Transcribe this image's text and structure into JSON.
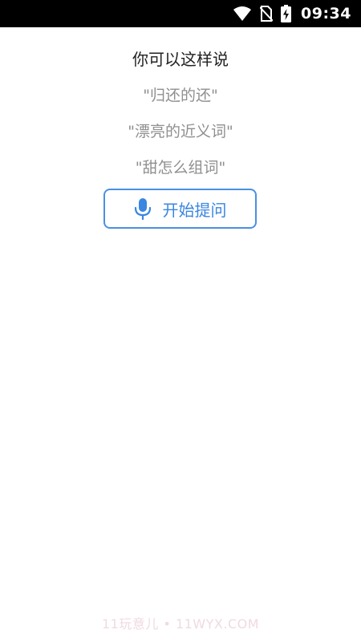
{
  "status_bar": {
    "time": "09:34",
    "icons": [
      "wifi-icon",
      "no-sim-icon",
      "battery-charging-icon"
    ]
  },
  "prompt": {
    "heading": "你可以这样说",
    "suggestions": [
      "\"归还的还\"",
      "\"漂亮的近义词\"",
      "\"甜怎么组词\""
    ]
  },
  "ask_button": {
    "label": "开始提问",
    "icon": "microphone-icon"
  },
  "watermark": "11玩意儿 • 11WYX.COM",
  "colors": {
    "accent": "#3a86e0",
    "suggestion_text": "#8f8f8f",
    "status_bar_bg": "#000000"
  }
}
